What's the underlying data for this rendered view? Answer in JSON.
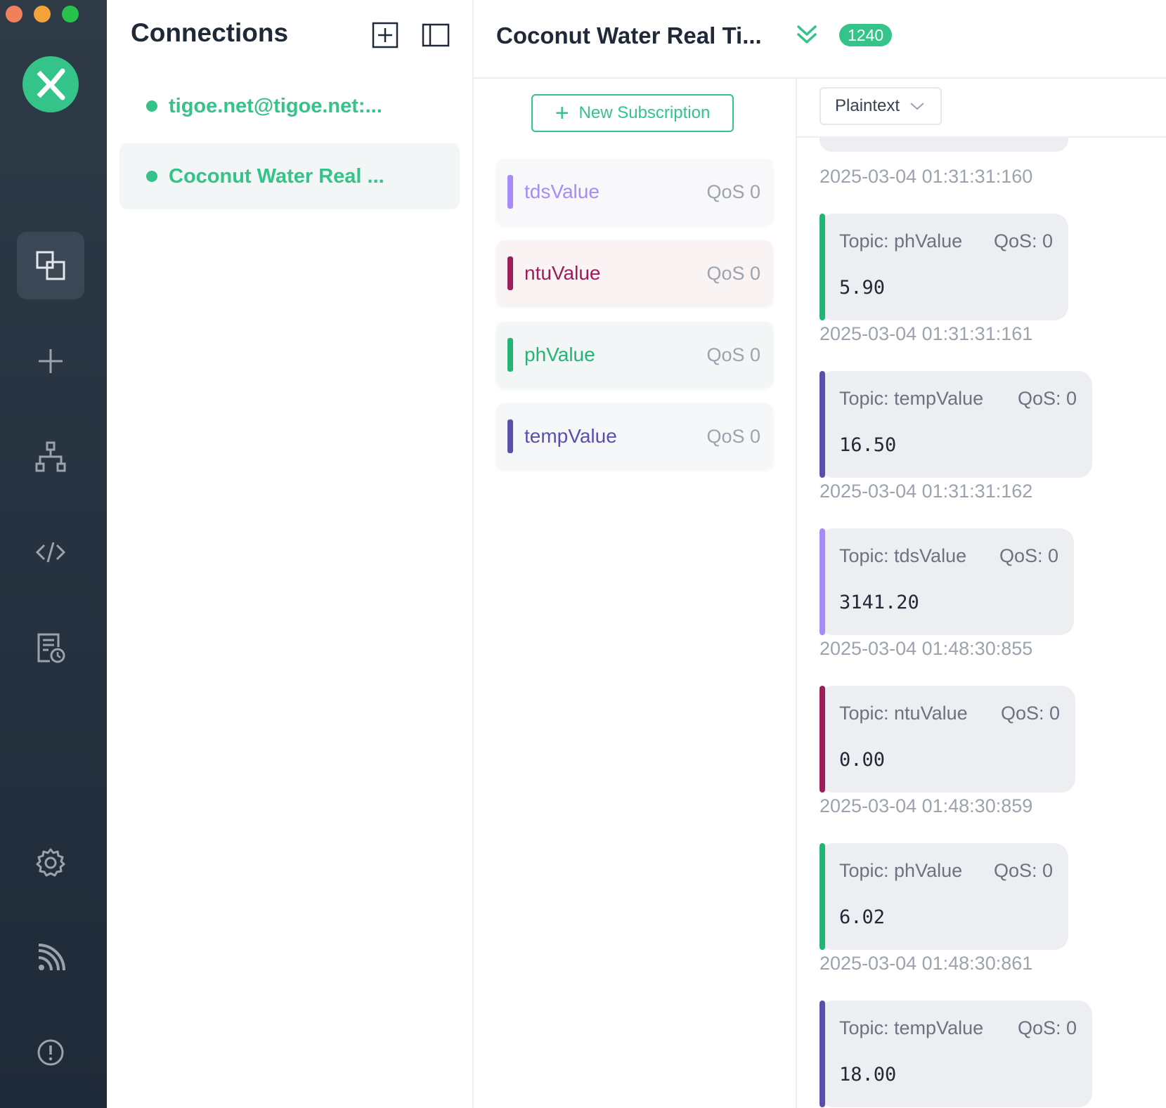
{
  "colors": {
    "accent": "#34c388",
    "tds": "#a78bfa",
    "ntu": "#9d1d5a",
    "ph": "#22b573",
    "temp": "#5b4fae"
  },
  "rail": {
    "icons": [
      "connections-icon",
      "plus-icon",
      "topology-icon",
      "code-icon",
      "log-icon",
      "gear-icon",
      "feed-icon",
      "info-icon"
    ]
  },
  "connections": {
    "title": "Connections",
    "items": [
      {
        "name": "tigoe.net@tigoe.net:..."
      },
      {
        "name": "Coconut Water Real ..."
      }
    ]
  },
  "header": {
    "title": "Coconut Water Real Ti...",
    "count": "1240"
  },
  "subscriptions": {
    "new_label": "New Subscription",
    "items": [
      {
        "topic": "tdsValue",
        "qos": "QoS 0"
      },
      {
        "topic": "ntuValue",
        "qos": "QoS 0"
      },
      {
        "topic": "phValue",
        "qos": "QoS 0"
      },
      {
        "topic": "tempValue",
        "qos": "QoS 0"
      }
    ]
  },
  "messages": {
    "format": "Plaintext",
    "first_time": "2025-03-04 01:31:31:160",
    "items": [
      {
        "topic": "Topic: phValue",
        "qos": "QoS: 0",
        "payload": "5.90",
        "time": "2025-03-04 01:31:31:161"
      },
      {
        "topic": "Topic: tempValue",
        "qos": "QoS: 0",
        "payload": "16.50",
        "time": "2025-03-04 01:31:31:162"
      },
      {
        "topic": "Topic: tdsValue",
        "qos": "QoS: 0",
        "payload": "3141.20",
        "time": "2025-03-04 01:48:30:855"
      },
      {
        "topic": "Topic: ntuValue",
        "qos": "QoS: 0",
        "payload": "0.00",
        "time": "2025-03-04 01:48:30:859"
      },
      {
        "topic": "Topic: phValue",
        "qos": "QoS: 0",
        "payload": "6.02",
        "time": "2025-03-04 01:48:30:861"
      },
      {
        "topic": "Topic: tempValue",
        "qos": "QoS: 0",
        "payload": "18.00",
        "time": ""
      }
    ]
  }
}
